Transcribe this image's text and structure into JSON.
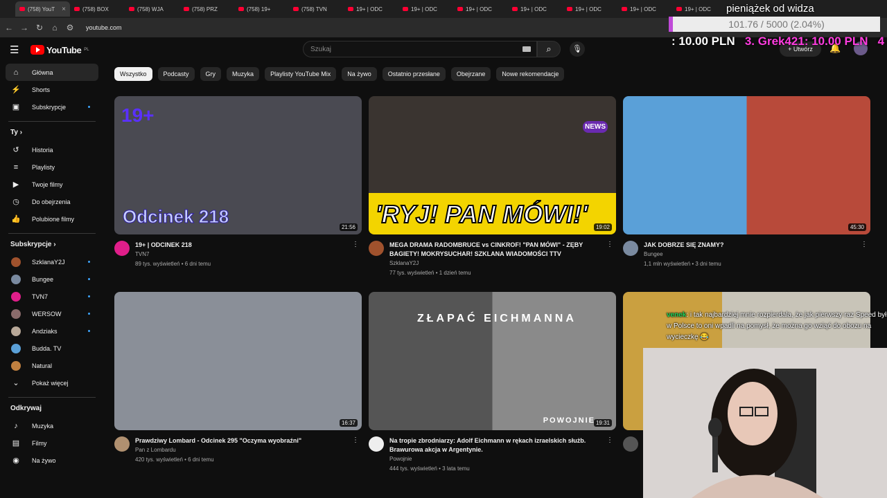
{
  "browser": {
    "tabs": [
      "(758) YouT",
      "(758) BOX",
      "(758) WJA",
      "(758) PRZ",
      "(758) 19+",
      "(758) TVN",
      "19+ | ODC",
      "19+ | ODC",
      "19+ | ODC",
      "19+ | ODC",
      "19+ | ODC",
      "19+ | ODC",
      "19+ | ODC"
    ],
    "url": "youtube.com"
  },
  "header": {
    "logo_text": "YouTube",
    "logo_region": "PL",
    "search_placeholder": "Szukaj",
    "create_label": "Utwórz",
    "notification_count": "9+"
  },
  "sidebar": {
    "main": [
      {
        "label": "Główna",
        "icon": "home-icon"
      },
      {
        "label": "Shorts",
        "icon": "shorts-icon"
      },
      {
        "label": "Subskrypcje",
        "icon": "subscriptions-icon"
      }
    ],
    "you_title": "Ty",
    "you": [
      {
        "label": "Historia",
        "icon": "history-icon"
      },
      {
        "label": "Playlisty",
        "icon": "playlist-icon"
      },
      {
        "label": "Twoje filmy",
        "icon": "your-videos-icon"
      },
      {
        "label": "Do obejrzenia",
        "icon": "watch-later-icon"
      },
      {
        "label": "Polubione filmy",
        "icon": "like-icon"
      }
    ],
    "subs_title": "Subskrypcje",
    "subs": [
      {
        "label": "SzklanaY2J",
        "color": "#a0522d",
        "dot": true
      },
      {
        "label": "Bungee",
        "color": "#7a8aa0",
        "dot": true
      },
      {
        "label": "TVN7",
        "color": "#e01e8a",
        "dot": true
      },
      {
        "label": "WERSOW",
        "color": "#8a6b6b",
        "dot": true
      },
      {
        "label": "Andziaks",
        "color": "#b8a898",
        "dot": true
      },
      {
        "label": "Budda. TV",
        "color": "#5aa0d8",
        "dot": false
      },
      {
        "label": "Natural",
        "color": "#c08040",
        "dot": false
      }
    ],
    "show_more": "Pokaż więcej",
    "explore_title": "Odkrywaj",
    "explore": [
      {
        "label": "Muzyka",
        "icon": "music-icon"
      },
      {
        "label": "Filmy",
        "icon": "film-icon"
      },
      {
        "label": "Na żywo",
        "icon": "live-icon"
      }
    ]
  },
  "chips": [
    "Wszystko",
    "Podcasty",
    "Gry",
    "Muzyka",
    "Playlisty YouTube Mix",
    "Na żywo",
    "Ostatnio przesłane",
    "Obejrzane",
    "Nowe rekomendacje"
  ],
  "videos": [
    {
      "title": "19+ | ODCINEK 218",
      "channel": "TVN7",
      "stats": "89 tys. wyświetleń • 6 dni temu",
      "duration": "21:56",
      "thumb_text": "Odcinek 218",
      "badge": "19+",
      "bg": "#4a4a52",
      "avatar": "#e01e8a"
    },
    {
      "title": "MEGA DRAMA RADOMBRUCE vs CINKROF! \"PAN MÓWI\" - ZĘBY BAGIETY! MOKRYSUCHAR! SZKLANA WIADOMOŚCI TTV",
      "channel": "SzklanaY2J",
      "stats": "77 tys. wyświetleń • 1 dzień temu",
      "duration": "19:02",
      "thumb_text": "'RYJ! PAN MÓWI!'",
      "badge": "NEWS",
      "bg": "#2c2a28",
      "avatar": "#a0522d"
    },
    {
      "title": "JAK DOBRZE SIĘ ZNAMY?",
      "channel": "Bungee",
      "stats": "1,1 mln wyświetleń • 3 dni temu",
      "duration": "45:30",
      "thumb_text": "",
      "badge": "",
      "bg": "#3a7ab8",
      "avatar": "#7a8aa0"
    },
    {
      "title": "Prawdziwy Lombard - Odcinek 295 \"Oczyma wyobraźni\"",
      "channel": "Pan z Lombardu",
      "stats": "420 tys. wyświetleń • 6 dni temu",
      "duration": "16:37",
      "thumb_text": "",
      "badge": "",
      "bg": "#8a8f98",
      "avatar": "#b09070"
    },
    {
      "title": "Na tropie zbrodniarzy: Adolf Eichmann w rękach izraelskich służb. Brawurowa akcja w Argentynie.",
      "channel": "Powojnie",
      "stats": "444 tys. wyświetleń • 3 lata temu",
      "duration": "19:31",
      "thumb_text": "ZŁAPAĆ EICHMANNA",
      "badge": "POWOJNIE",
      "bg": "#555",
      "avatar": "#eee"
    },
    {
      "title": "",
      "channel": "",
      "stats": "",
      "duration": "",
      "thumb_text": "",
      "badge": "",
      "bg": "#c8b84a",
      "avatar": "#555"
    }
  ],
  "overlay": {
    "donate_title": "pieniążek od widza",
    "donate_progress": "101.76 / 5000 (2.04%)",
    "donate_line_a": ": 10.00 PLN",
    "donate_line_b": "3. Grek421: 10.00 PLN",
    "donate_line_c": "4",
    "chat_user": "venek",
    "chat_message": ": i tak najbardziej mnie rozpierdala, że jak pierwszy raz Speed był w Polsce to oni wpadli na pomysł, że można go wziąć do obozu na wycieczkę 😂"
  },
  "colors": {
    "bg": "#0f0f0f",
    "accent": "#ff0000",
    "overlay_pink": "#ff3ce0",
    "chat_user": "#1fd35a"
  }
}
